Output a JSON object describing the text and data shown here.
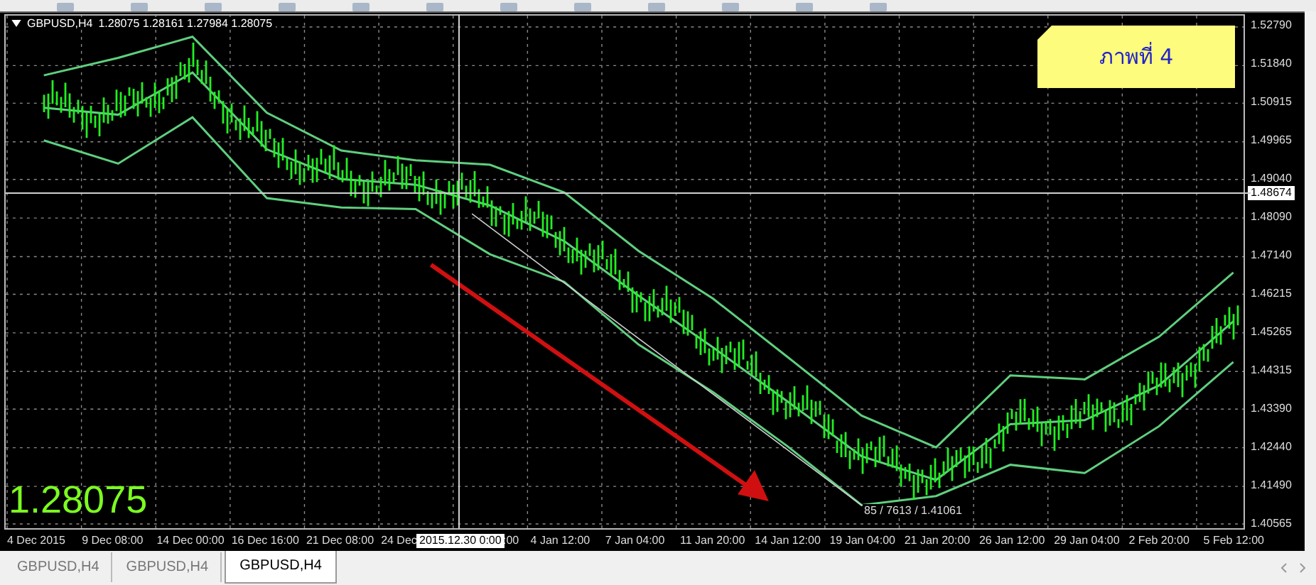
{
  "chart": {
    "symbol": "GBPUSD,H4",
    "quote": "1.28075 1.28161 1.27984 1.28075",
    "note": "ภาพที่ 4",
    "last_price": "1.28075",
    "price_marker": "1.48674",
    "crosshair_date": "2015.12.30 0:00",
    "crosshair_info": "85 / 7613 / 1.41061",
    "chart_data": {
      "type": "line",
      "ylim": [
        1.40461,
        1.53069
      ],
      "grid": true,
      "series": [
        {
          "color": "#5fcf7f",
          "values": [
            1.516,
            1.5203,
            1.5255,
            1.5068,
            1.4975,
            1.4951,
            1.494,
            1.4872,
            1.4728,
            1.4611,
            1.4468,
            1.4323,
            1.4245,
            1.4422,
            1.4412,
            1.4517,
            1.4675
          ]
        },
        {
          "color": "#5fcf7f",
          "values": [
            1.508,
            1.5063,
            1.5167,
            1.4978,
            1.4905,
            1.4891,
            1.484,
            1.4752,
            1.4618,
            1.4491,
            1.4358,
            1.4223,
            1.4165,
            1.4302,
            1.4312,
            1.4397,
            1.4555
          ]
        },
        {
          "color": "#5fcf7f",
          "values": [
            1.5,
            1.4943,
            1.5057,
            1.4858,
            1.4835,
            1.4831,
            1.472,
            1.4652,
            1.4498,
            1.4381,
            1.4248,
            1.4103,
            1.4125,
            1.4202,
            1.4182,
            1.4297,
            1.4455
          ]
        }
      ],
      "yticks": [
        {
          "value": 1.5279,
          "label": "1.52790"
        },
        {
          "value": 1.5184,
          "label": "1.51840"
        },
        {
          "value": 1.50915,
          "label": "1.50915"
        },
        {
          "value": 1.49965,
          "label": "1.49965"
        },
        {
          "value": 1.4904,
          "label": "1.49040"
        },
        {
          "value": 1.4809,
          "label": "1.48090"
        },
        {
          "value": 1.4714,
          "label": "1.47140"
        },
        {
          "value": 1.46215,
          "label": "1.46215"
        },
        {
          "value": 1.45265,
          "label": "1.45265"
        },
        {
          "value": 1.44315,
          "label": "1.44315"
        },
        {
          "value": 1.4339,
          "label": "1.43390"
        },
        {
          "value": 1.4244,
          "label": "1.42440"
        },
        {
          "value": 1.4149,
          "label": "1.41490"
        },
        {
          "value": 1.40565,
          "label": "1.40565"
        }
      ],
      "categories": [
        "4 Dec 2015",
        "9 Dec 08:00",
        "14 Dec 00:00",
        "16 Dec 16:00",
        "21 Dec 08:00",
        "24 Dec",
        null,
        "4 Jan 12:00",
        "7 Jan 04:00",
        "11 Jan 20:00",
        "14 Jan 12:00",
        "19 Jan 04:00",
        "21 Jan 20:00",
        "26 Jan 12:00",
        "29 Jan 04:00",
        "2 Feb 20:00",
        "5 Feb 12:00"
      ]
    },
    "time_fragment": ":00"
  },
  "tabs": [
    {
      "label": "GBPUSD,H4",
      "selected": false
    },
    {
      "label": "GBPUSD,H4",
      "selected": false
    },
    {
      "label": "GBPUSD,H4",
      "selected": true
    }
  ]
}
